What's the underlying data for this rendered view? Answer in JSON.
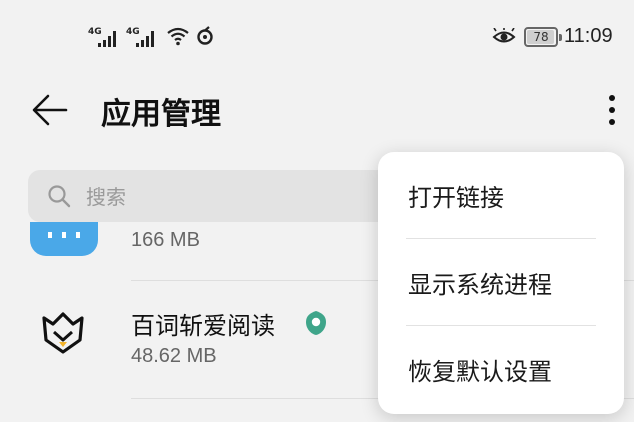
{
  "status_bar": {
    "signal1_label": "4G",
    "signal2_label": "4G",
    "battery": "78",
    "time": "11:09"
  },
  "app_bar": {
    "title": "应用管理"
  },
  "search": {
    "placeholder": "搜索"
  },
  "apps": [
    {
      "name": "",
      "size": "166 MB"
    },
    {
      "name": "百词斩爱阅读",
      "size": "48.62 MB"
    }
  ],
  "menu": {
    "items": [
      {
        "label": "打开链接"
      },
      {
        "label": "显示系统进程"
      },
      {
        "label": "恢复默认设置"
      }
    ]
  },
  "colors": {
    "background": "#f2f2f2",
    "menu_bg": "#ffffff",
    "partial_icon": "#4aa8e8",
    "badge": "#3fa58a"
  }
}
